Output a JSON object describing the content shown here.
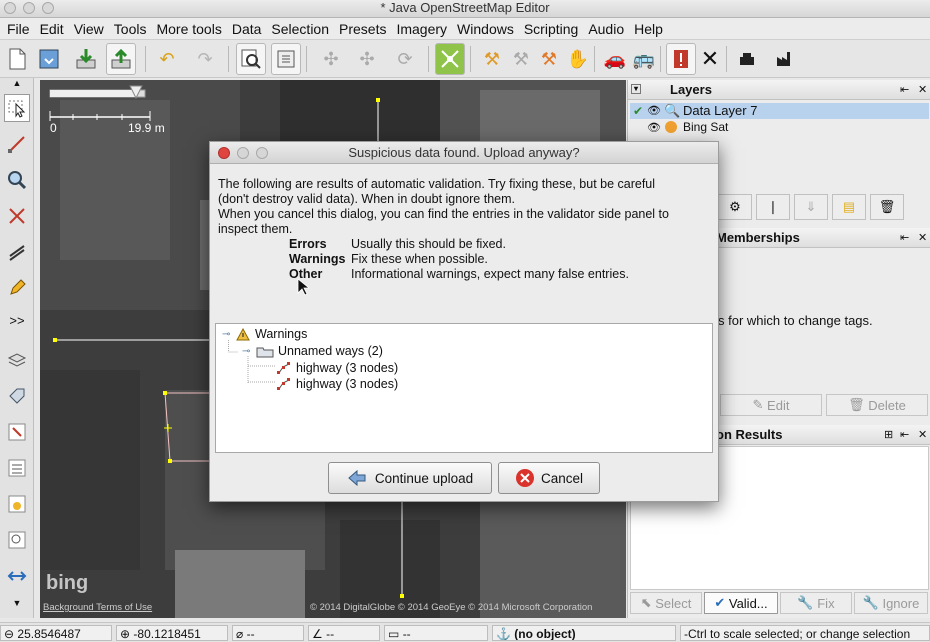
{
  "window": {
    "title": "* Java OpenStreetMap Editor"
  },
  "menu": [
    "File",
    "Edit",
    "View",
    "Tools",
    "More tools",
    "Data",
    "Selection",
    "Presets",
    "Imagery",
    "Windows",
    "Scripting",
    "Audio",
    "Help"
  ],
  "map": {
    "scale_start": "0",
    "scale_end": "19.9 m",
    "bing_logo": "bing",
    "terms": "Background Terms of Use",
    "copyright": "© 2014 DigitalGlobe © 2014 GeoEye © 2014 Microsoft Corporation"
  },
  "layers_panel": {
    "title": "Layers",
    "layers": [
      "Data Layer 7",
      "Bing Sat"
    ]
  },
  "memberships_panel": {
    "title": "Memberships",
    "text": "s for which to change tags.",
    "edit": "Edit",
    "delete": "Delete"
  },
  "validation_panel": {
    "title": "on Results",
    "buttons": [
      "Select",
      "Valid...",
      "Fix",
      "Ignore"
    ]
  },
  "status": {
    "lat": "25.8546487",
    "lon": "-80.1218451",
    "heading": "--",
    "angle": "--",
    "distance": "--",
    "object": "(no object)",
    "help": "-Ctrl to scale selected; or change selection"
  },
  "dialog": {
    "title": "Suspicious data found. Upload anyway?",
    "line1": "The following are results of automatic validation. Try fixing these, but be careful",
    "line2": "(don't destroy valid data). When in doubt ignore them.",
    "line3": "When you cancel this dialog, you can find the entries in the validator side panel to",
    "line4": "inspect them.",
    "legend": [
      {
        "label": "Errors",
        "text": "Usually this should be fixed."
      },
      {
        "label": "Warnings",
        "text": "Fix these when possible."
      },
      {
        "label": "Other",
        "text": "Informational warnings, expect many false entries."
      }
    ],
    "tree": {
      "root": "Warnings",
      "group": "Unnamed ways (2)",
      "items": [
        "highway (3 nodes)",
        "highway (3 nodes)"
      ]
    },
    "continue_label": "Continue upload",
    "cancel_label": "Cancel"
  }
}
